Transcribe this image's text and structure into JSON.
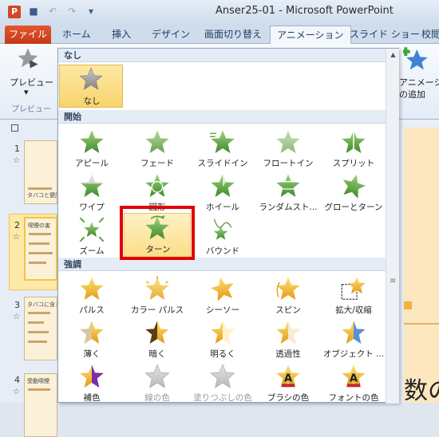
{
  "window": {
    "title": "Anser25-01 - Microsoft PowerPoint",
    "app_icon_letter": "P"
  },
  "tabs": [
    {
      "label": "ファイル"
    },
    {
      "label": "ホーム"
    },
    {
      "label": "挿入"
    },
    {
      "label": "デザイン"
    },
    {
      "label": "画面切り替え"
    },
    {
      "label": "アニメーション"
    },
    {
      "label": "スライド ショー"
    },
    {
      "label": "校閲"
    }
  ],
  "ribbon": {
    "preview_label": "プレビュー",
    "preview_group_label": "プレビュー",
    "add_animation_label_1": "アニメーション",
    "add_animation_label_2": "の追加",
    "dropdown_glyph": "▾"
  },
  "slides": [
    {
      "number": "1",
      "star": "☆"
    },
    {
      "number": "2",
      "star": "☆"
    },
    {
      "number": "3",
      "star": "☆"
    },
    {
      "number": "4",
      "star": "☆"
    }
  ],
  "slide_thumbs": {
    "s1_text": "タバコと健康",
    "s2_text": "喫煙の害",
    "s3_text": "タバコに含まれる",
    "s4_text": "受動喫煙"
  },
  "canvas": {
    "big_text": "数の"
  },
  "gallery": {
    "sections": [
      {
        "title": "なし",
        "items": [
          {
            "label": "なし",
            "icon": "gray-star-icon"
          }
        ]
      },
      {
        "title": "開始",
        "items": [
          {
            "label": "アピール",
            "icon": "appear-star-icon"
          },
          {
            "label": "フェード",
            "icon": "fade-star-icon"
          },
          {
            "label": "スライドイン",
            "icon": "fly-in-star-icon"
          },
          {
            "label": "フロートイン",
            "icon": "float-in-star-icon"
          },
          {
            "label": "スプリット",
            "icon": "split-star-icon"
          },
          {
            "label": "ワイプ",
            "icon": "wipe-star-icon"
          },
          {
            "label": "図形",
            "icon": "shape-star-icon"
          },
          {
            "label": "ホイール",
            "icon": "wheel-star-icon"
          },
          {
            "label": "ランダムスト...",
            "icon": "random-bars-star-icon"
          },
          {
            "label": "グローとターン",
            "icon": "grow-turn-star-icon"
          },
          {
            "label": "ズーム",
            "icon": "zoom-star-icon"
          },
          {
            "label": "ターン",
            "icon": "turn-star-icon"
          },
          {
            "label": "バウンド",
            "icon": "bounce-star-icon"
          }
        ]
      },
      {
        "title": "強調",
        "items": [
          {
            "label": "パルス",
            "icon": "pulse-star-icon"
          },
          {
            "label": "カラー パルス",
            "icon": "color-pulse-star-icon"
          },
          {
            "label": "シーソー",
            "icon": "teeter-star-icon"
          },
          {
            "label": "スピン",
            "icon": "spin-star-icon"
          },
          {
            "label": "拡大/収縮",
            "icon": "grow-shrink-star-icon"
          },
          {
            "label": "薄く",
            "icon": "desaturate-star-icon"
          },
          {
            "label": "暗く",
            "icon": "darken-star-icon"
          },
          {
            "label": "明るく",
            "icon": "lighten-star-icon"
          },
          {
            "label": "透過性",
            "icon": "transparency-star-icon"
          },
          {
            "label": "オブジェクト ...",
            "icon": "object-color-star-icon"
          },
          {
            "label": "補色",
            "icon": "complementary-color-star-icon"
          },
          {
            "label": "線の色",
            "icon": "line-color-star-icon"
          },
          {
            "label": "塗りつぶしの色",
            "icon": "fill-color-star-icon"
          },
          {
            "label": "ブラシの色",
            "icon": "brush-color-star-icon"
          },
          {
            "label": "フォントの色",
            "icon": "font-color-star-icon"
          }
        ]
      }
    ],
    "selected_item": "ターン"
  },
  "colors": {
    "file_tab": "#d24726",
    "green_star": "#5aa13c",
    "gold_star": "#f2b51c",
    "selection_outline": "#e30000"
  }
}
